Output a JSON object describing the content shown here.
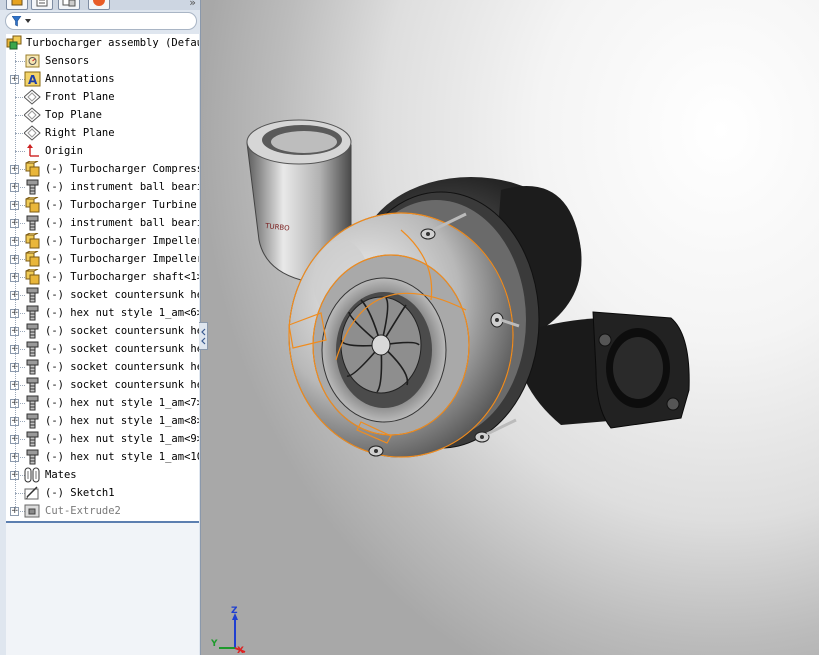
{
  "feature_tree": {
    "root": {
      "label": "Turbocharger assembly  (Defau",
      "icon": "assembly-icon"
    },
    "items": [
      {
        "label": "Sensors",
        "icon": "sensor-icon",
        "expander": false
      },
      {
        "label": "Annotations",
        "icon": "annotation-icon",
        "expander": true
      },
      {
        "label": "Front Plane",
        "icon": "plane-icon",
        "expander": false
      },
      {
        "label": "Top Plane",
        "icon": "plane-icon",
        "expander": false
      },
      {
        "label": "Right Plane",
        "icon": "plane-icon",
        "expander": false
      },
      {
        "label": "Origin",
        "icon": "origin-icon",
        "expander": false
      },
      {
        "label": "(-) Turbocharger Compresso",
        "icon": "subassembly-icon",
        "expander": true
      },
      {
        "label": "(-) instrument ball bearin",
        "icon": "part-icon",
        "expander": true
      },
      {
        "label": "(-) Turbocharger Turbine h",
        "icon": "subassembly-icon",
        "expander": true
      },
      {
        "label": "(-) instrument ball bearin",
        "icon": "part-icon",
        "expander": true
      },
      {
        "label": "(-) Turbocharger Impeller<",
        "icon": "subassembly-icon",
        "expander": true
      },
      {
        "label": "(-) Turbocharger Impeller<",
        "icon": "subassembly-icon",
        "expander": true
      },
      {
        "label": "(-) Turbocharger shaft<1>",
        "icon": "subassembly-icon",
        "expander": true
      },
      {
        "label": "(-) socket countersunk hea",
        "icon": "part-icon",
        "expander": true
      },
      {
        "label": "(-) hex nut style 1_am<6>",
        "icon": "part-icon",
        "expander": true
      },
      {
        "label": "(-) socket countersunk hea",
        "icon": "part-icon",
        "expander": true
      },
      {
        "label": "(-) socket countersunk hea",
        "icon": "part-icon",
        "expander": true
      },
      {
        "label": "(-) socket countersunk hea",
        "icon": "part-icon",
        "expander": true
      },
      {
        "label": "(-) socket countersunk hea",
        "icon": "part-icon",
        "expander": true
      },
      {
        "label": "(-) hex nut style 1_am<7>",
        "icon": "part-icon",
        "expander": true
      },
      {
        "label": "(-) hex nut style 1_am<8>",
        "icon": "part-icon",
        "expander": true
      },
      {
        "label": "(-) hex nut style 1_am<9>",
        "icon": "part-icon",
        "expander": true
      },
      {
        "label": "(-) hex nut style 1_am<10>",
        "icon": "part-icon",
        "expander": true
      },
      {
        "label": "Mates",
        "icon": "mates-icon",
        "expander": true
      },
      {
        "label": "(-) Sketch1",
        "icon": "sketch-icon",
        "expander": false
      },
      {
        "label": "Cut-Extrude2",
        "icon": "cut-extrude-icon",
        "expander": true,
        "suppressed": true
      }
    ]
  },
  "graphics": {
    "model_name": "Turbocharger assembly",
    "housing_text": "TURBO",
    "selection_color": "#f08c1e",
    "triad": {
      "z": "Z",
      "y": "Y",
      "x": "X"
    }
  },
  "colors": {
    "panel_bg": "#dfe6ef",
    "highlight": "#f08c1e",
    "tree_bg": "#ffffff"
  }
}
